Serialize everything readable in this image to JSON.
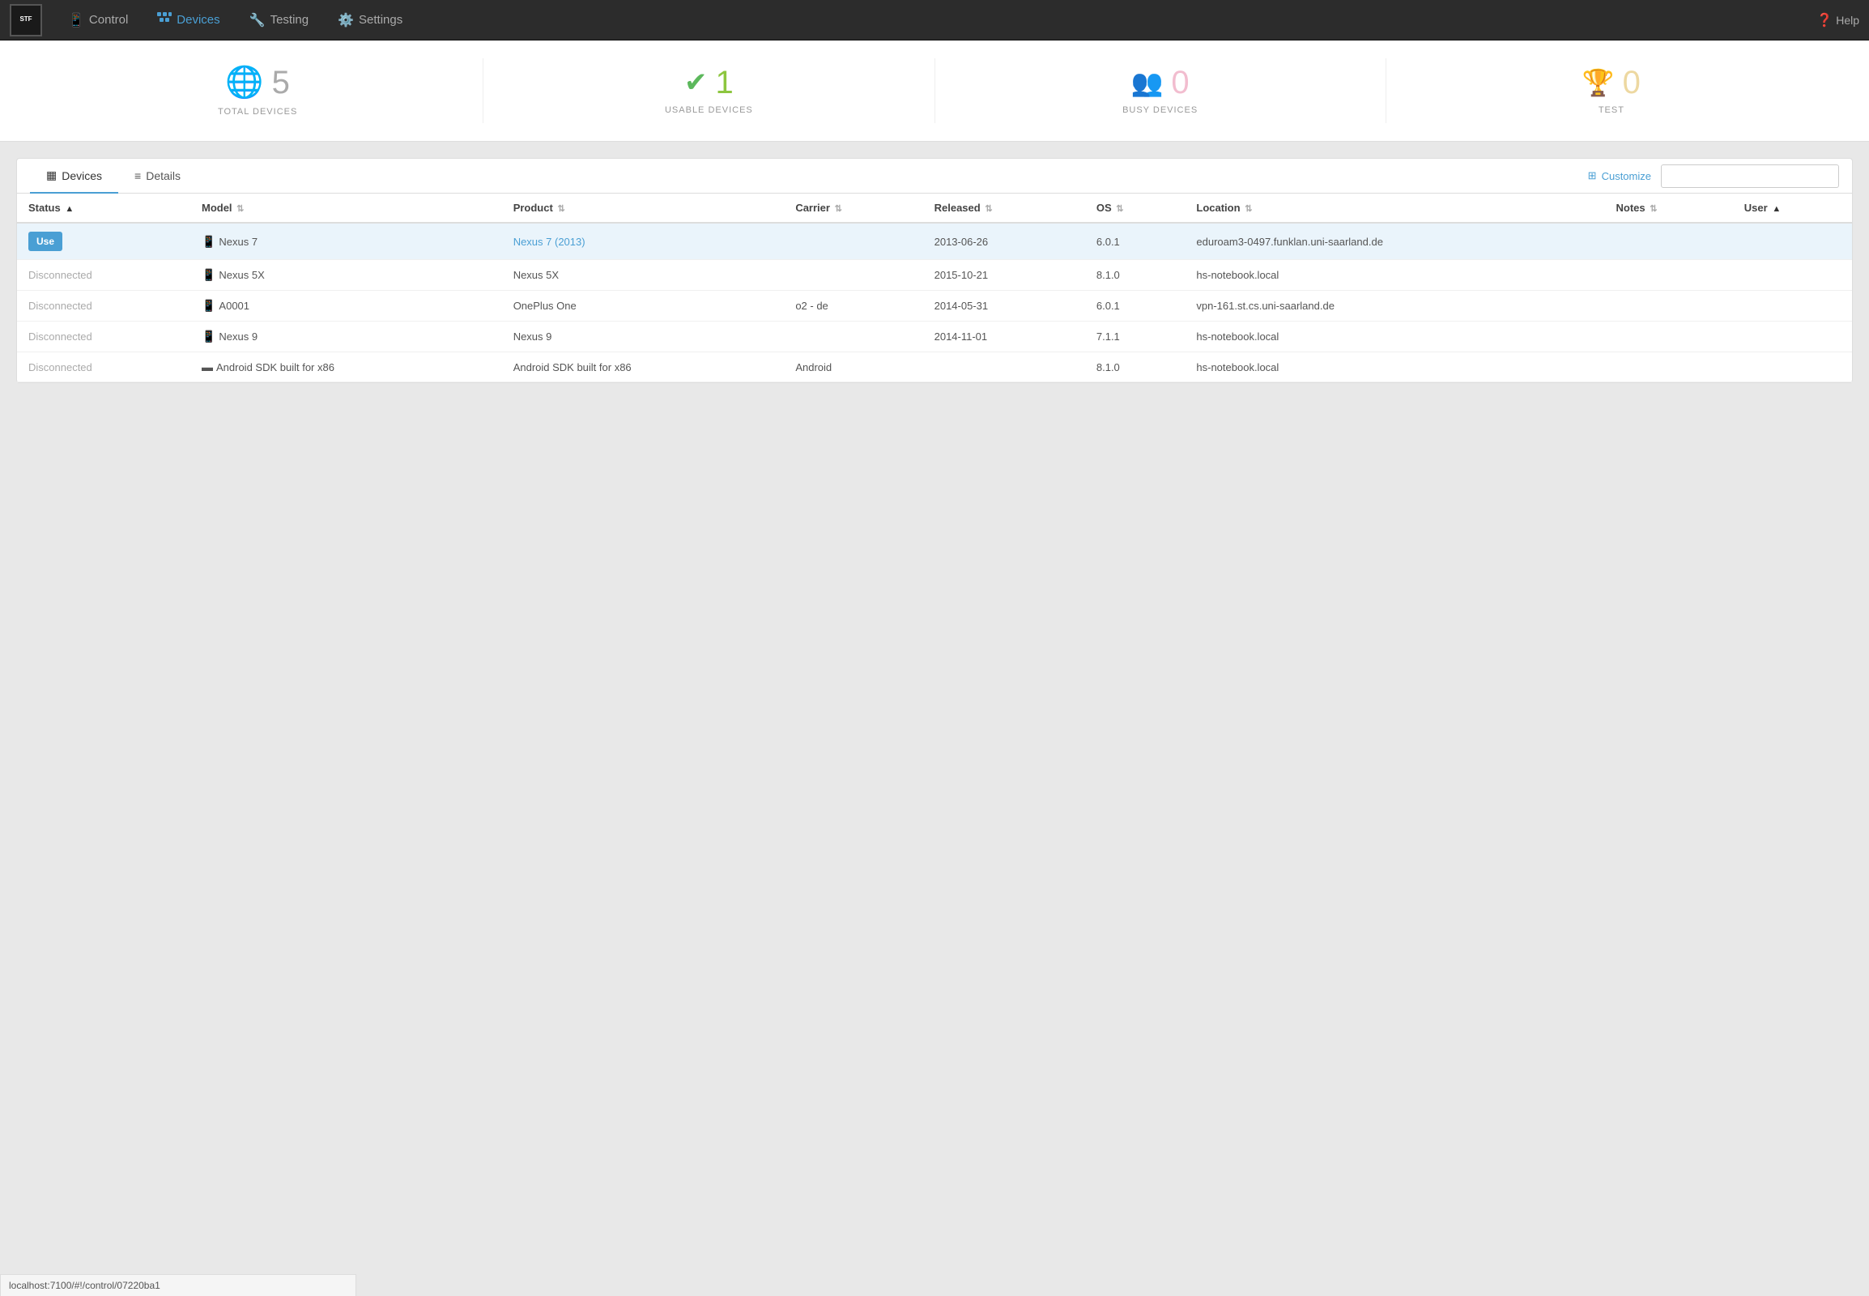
{
  "app": {
    "brand": "STF",
    "brand_sub": "STF"
  },
  "navbar": {
    "items": [
      {
        "id": "control",
        "label": "Control",
        "icon": "📱",
        "active": false
      },
      {
        "id": "devices",
        "label": "Devices",
        "icon": "🔗",
        "active": true
      },
      {
        "id": "testing",
        "label": "Testing",
        "icon": "🔧",
        "active": false
      },
      {
        "id": "settings",
        "label": "Settings",
        "icon": "⚙️",
        "active": false
      }
    ],
    "help_label": "Help"
  },
  "stats": [
    {
      "id": "total",
      "icon": "🌐",
      "icon_color": "blue",
      "number": "5",
      "number_color": "normal",
      "label": "TOTAL DEVICES"
    },
    {
      "id": "usable",
      "icon": "✔",
      "icon_color": "green",
      "number": "1",
      "number_color": "green",
      "label": "USABLE DEVICES"
    },
    {
      "id": "busy",
      "icon": "👥",
      "icon_color": "pink",
      "number": "0",
      "number_color": "pink",
      "label": "BUSY DEVICES"
    },
    {
      "id": "test",
      "icon": "🏆",
      "icon_color": "gold",
      "number": "0",
      "number_color": "gold",
      "label": "TEST"
    }
  ],
  "panel": {
    "tabs": [
      {
        "id": "devices",
        "label": "Devices",
        "icon": "▦",
        "active": true
      },
      {
        "id": "details",
        "label": "Details",
        "icon": "≡",
        "active": false
      }
    ],
    "customize_label": "Customize",
    "search_placeholder": ""
  },
  "table": {
    "columns": [
      {
        "id": "status",
        "label": "Status",
        "sortable": true,
        "sort_dir": "asc"
      },
      {
        "id": "model",
        "label": "Model",
        "sortable": true
      },
      {
        "id": "product",
        "label": "Product",
        "sortable": true
      },
      {
        "id": "carrier",
        "label": "Carrier",
        "sortable": true
      },
      {
        "id": "released",
        "label": "Released",
        "sortable": true
      },
      {
        "id": "os",
        "label": "OS",
        "sortable": true
      },
      {
        "id": "location",
        "label": "Location",
        "sortable": true
      },
      {
        "id": "notes",
        "label": "Notes",
        "sortable": true
      },
      {
        "id": "user",
        "label": "User",
        "sortable": true,
        "sort_dir": "asc"
      }
    ],
    "rows": [
      {
        "status": "Use",
        "status_type": "use",
        "model": "Nexus 7",
        "model_icon": "📱",
        "product": "Nexus 7 (2013)",
        "product_link": true,
        "carrier": "",
        "released": "2013-06-26",
        "os": "6.0.1",
        "location": "eduroam3-0497.funklan.uni-saarland.de",
        "notes": "",
        "user": ""
      },
      {
        "status": "Disconnected",
        "status_type": "disconnected",
        "model": "Nexus 5X",
        "model_icon": "📱",
        "product": "Nexus 5X",
        "product_link": false,
        "carrier": "",
        "released": "2015-10-21",
        "os": "8.1.0",
        "location": "hs-notebook.local",
        "notes": "",
        "user": ""
      },
      {
        "status": "Disconnected",
        "status_type": "disconnected",
        "model": "A0001",
        "model_icon": "📱",
        "product": "OnePlus One",
        "product_link": false,
        "carrier": "o2 - de",
        "released": "2014-05-31",
        "os": "6.0.1",
        "location": "vpn-161.st.cs.uni-saarland.de",
        "notes": "",
        "user": ""
      },
      {
        "status": "Disconnected",
        "status_type": "disconnected",
        "model": "Nexus 9",
        "model_icon": "📱",
        "product": "Nexus 9",
        "product_link": false,
        "carrier": "",
        "released": "2014-11-01",
        "os": "7.1.1",
        "location": "hs-notebook.local",
        "notes": "",
        "user": ""
      },
      {
        "status": "Disconnected",
        "status_type": "disconnected",
        "model": "Android SDK built for x86",
        "model_icon": "📱",
        "product": "Android SDK built for x86",
        "product_link": false,
        "carrier": "Android",
        "released": "",
        "os": "8.1.0",
        "location": "hs-notebook.local",
        "notes": "",
        "user": ""
      }
    ]
  },
  "status_bar": {
    "url": "localhost:7100/#!/control/07220ba1"
  }
}
